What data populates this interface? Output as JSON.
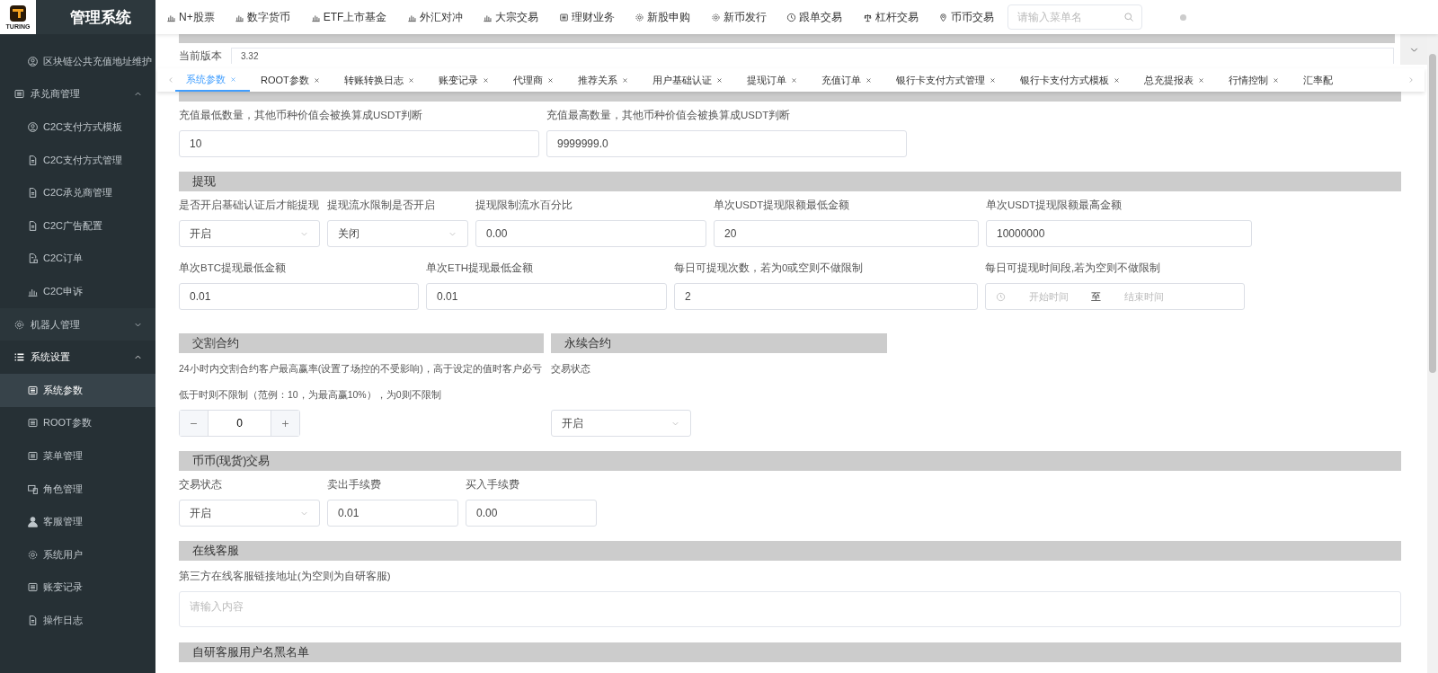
{
  "sidebar": {
    "logo_text": "TURING",
    "title": "管理系统",
    "items": [
      {
        "label": "区块链公共充值地址维护",
        "kind": "sub",
        "selected": false
      },
      {
        "label": "承兑商管理",
        "kind": "group",
        "expanded": true,
        "children": [
          {
            "label": "C2C支付方式模板",
            "selected": false
          },
          {
            "label": "C2C支付方式管理",
            "selected": false
          },
          {
            "label": "C2C承兑商管理",
            "selected": false
          },
          {
            "label": "C2C广告配置",
            "selected": false
          },
          {
            "label": "C2C订单",
            "selected": false
          },
          {
            "label": "C2C申诉",
            "selected": false
          }
        ]
      },
      {
        "label": "机器人管理",
        "kind": "group",
        "expanded": false
      },
      {
        "label": "系统设置",
        "kind": "group",
        "expanded": true,
        "children": [
          {
            "label": "系统参数",
            "selected": true
          },
          {
            "label": "ROOT参数",
            "selected": false
          },
          {
            "label": "菜单管理",
            "selected": false
          },
          {
            "label": "角色管理",
            "selected": false
          },
          {
            "label": "客服管理",
            "selected": false
          },
          {
            "label": "系统用户",
            "selected": false
          },
          {
            "label": "账变记录",
            "selected": false
          },
          {
            "label": "操作日志",
            "selected": false
          }
        ]
      }
    ]
  },
  "top_nav": {
    "items": [
      "N+股票",
      "数字货币",
      "ETF上市基金",
      "外汇对冲",
      "大宗交易",
      "理财业务",
      "新股申购",
      "新币发行",
      "跟单交易",
      "杠杆交易",
      "币币交易"
    ],
    "search": {
      "placeholder": "请输入菜单名"
    }
  },
  "app_section": {
    "version_label": "当前版本",
    "version_value": "3.32"
  },
  "tabs": [
    {
      "label": "系统参数",
      "selected": true
    },
    {
      "label": "ROOT参数",
      "selected": false
    },
    {
      "label": "转账转换日志",
      "selected": false
    },
    {
      "label": "账变记录",
      "selected": false
    },
    {
      "label": "代理商",
      "selected": false
    },
    {
      "label": "推荐关系",
      "selected": false
    },
    {
      "label": "用户基础认证",
      "selected": false
    },
    {
      "label": "提现订单",
      "selected": false
    },
    {
      "label": "充值订单",
      "selected": false
    },
    {
      "label": "银行卡支付方式管理",
      "selected": false
    },
    {
      "label": "银行卡支付方式模板",
      "selected": false
    },
    {
      "label": "总充提报表",
      "selected": false
    },
    {
      "label": "行情控制",
      "selected": false
    },
    {
      "label": "汇率配"
    }
  ],
  "recharge": {
    "fields": [
      {
        "kind": "input",
        "label": "充值最低数量，其他币种价值会被换算成USDT判断",
        "value": "10"
      },
      {
        "kind": "input",
        "label": "充值最高数量，其他币种价值会被换算成USDT判断",
        "value": "9999999.0"
      }
    ]
  },
  "withdraw": {
    "title": "提现",
    "fields": [
      {
        "kind": "select",
        "label": "是否开启基础认证后才能提现",
        "value": "开启"
      },
      {
        "kind": "select",
        "label": "提现流水限制是否开启",
        "value": "关闭"
      },
      {
        "kind": "input",
        "label": "提现限制流水百分比",
        "value": "0.00"
      },
      {
        "kind": "input",
        "label": "单次USDT提现限额最低金额",
        "value": "20"
      },
      {
        "kind": "input",
        "label": "单次USDT提现限额最高金额",
        "value": "10000000"
      },
      {
        "kind": "input",
        "label": "单次BTC提现最低金额",
        "value": "0.01"
      },
      {
        "kind": "input",
        "label": "单次ETH提现最低金额",
        "value": "0.01"
      },
      {
        "kind": "input",
        "label": "每日可提现次数，若为0或空则不做限制",
        "value": "2"
      },
      {
        "kind": "time_range",
        "label": "每日可提现时间段,若为空则不做限制",
        "start_placeholder": "开始时间",
        "separator": "至",
        "end_placeholder": "结束时间"
      }
    ]
  },
  "contracts": [
    {
      "title": "交割合约",
      "description": [
        "24小时内交割合约客户最高赢率(设置了场控的不受影响)，高于设定的值时客户必亏",
        "低于时则不限制（范例：10，为最高赢10%），为0则不限制"
      ],
      "field": {
        "kind": "stepper",
        "value": "0"
      }
    },
    {
      "title": "永续合约",
      "description": [
        "交易状态"
      ],
      "field": {
        "kind": "select",
        "value": "开启"
      }
    }
  ],
  "spot": {
    "title": "币币(现货)交易",
    "fields": [
      {
        "kind": "select",
        "label": "交易状态",
        "value": "开启"
      },
      {
        "kind": "input",
        "label": "卖出手续费",
        "value": "0.01"
      },
      {
        "kind": "input",
        "label": "买入手续费",
        "value": "0.00"
      }
    ]
  },
  "online_service": {
    "title": "在线客服",
    "label": "第三方在线客服链接地址(为空则为自研客服)",
    "placeholder": "请输入内容"
  },
  "blacklist": {
    "title": "自研客服用户名黑名单"
  }
}
